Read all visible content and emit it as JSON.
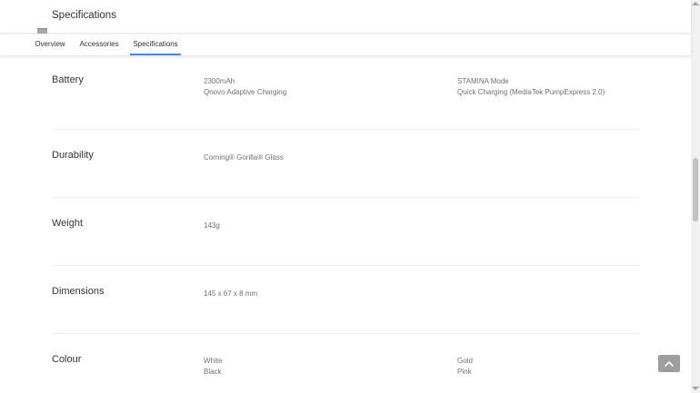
{
  "header": {
    "title": "Specifications"
  },
  "tabs": [
    {
      "label": "Overview",
      "active": false
    },
    {
      "label": "Accessories",
      "active": false
    },
    {
      "label": "Specifications",
      "active": true
    }
  ],
  "accent_color": "#4a86e8",
  "sections": {
    "battery": {
      "label": "Battery",
      "col1": [
        "2300mAh",
        "Qnovo Adaptive Charging"
      ],
      "col2": [
        "STAMINA Mode",
        "Quick Charging (MediaTek PumpExpress 2.0)"
      ]
    },
    "durability": {
      "label": "Durability",
      "col1": [
        "Corning® Gorilla® Glass"
      ]
    },
    "weight": {
      "label": "Weight",
      "col1": [
        "143g"
      ]
    },
    "dimensions": {
      "label": "Dimensions",
      "col1": [
        "145 x 67 x 8 mm"
      ]
    },
    "colour": {
      "label": "Colour",
      "col1": [
        "White",
        "Black"
      ],
      "col2": [
        "Gold",
        "Pink"
      ]
    }
  },
  "icons": {
    "back_to_top": "chevron-up-icon"
  }
}
